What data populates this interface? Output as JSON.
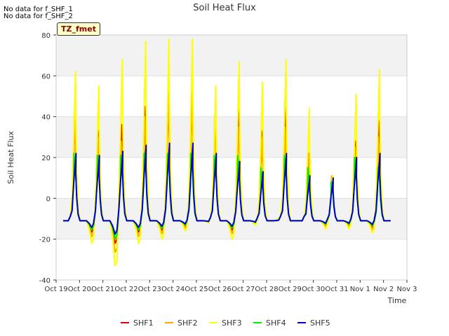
{
  "notes": [
    "No data for f_SHF_1",
    "No data for f_SHF_2"
  ],
  "tz_label": "TZ_fmet",
  "chart_data": {
    "type": "line",
    "title": "Soil Heat Flux",
    "xlabel": "Time",
    "ylabel": "Soil Heat Flux",
    "xlim": [
      0,
      15
    ],
    "ylim": [
      -40,
      80
    ],
    "yticks": [
      -40,
      -20,
      0,
      20,
      40,
      60,
      80
    ],
    "xtick_labels": [
      "Oct 19",
      "Oct 20",
      "Oct 21",
      "Oct 22",
      "Oct 23",
      "Oct 24",
      "Oct 25",
      "Oct 26",
      "Oct 27",
      "Oct 28",
      "Oct 29",
      "Oct 30",
      "Oct 31",
      "Nov 1",
      "Nov 2",
      "Nov 3"
    ],
    "grid_bands": true,
    "legend_position": "bottom",
    "daily": {
      "start_day": 0.3,
      "base": [
        -11,
        -11,
        -11,
        -11,
        -11,
        -11,
        -11,
        -11,
        -11,
        -11,
        -11,
        -11,
        -11,
        -11
      ],
      "trough": [
        -11,
        -22,
        -33,
        -22,
        -20,
        -16,
        -12,
        -20,
        -13,
        -10,
        -11,
        -15,
        -15,
        -17
      ]
    },
    "series": [
      {
        "name": "SHF1",
        "color": "#dd0000",
        "peaks": [
          44,
          33,
          36,
          45,
          55,
          55,
          45,
          45,
          33,
          45,
          22,
          10,
          28,
          38
        ],
        "trough_scale": 0.5
      },
      {
        "name": "SHF2",
        "color": "#ffa500",
        "peaks": [
          42,
          30,
          28,
          40,
          50,
          50,
          40,
          35,
          30,
          35,
          22,
          11,
          25,
          30
        ],
        "trough_scale": 0.7
      },
      {
        "name": "SHF3",
        "color": "#ffff00",
        "peaks": [
          62,
          55,
          68,
          77,
          78,
          78,
          55,
          67,
          57,
          68,
          44,
          11,
          51,
          63
        ],
        "trough_scale": 1.0
      },
      {
        "name": "SHF4",
        "color": "#00ee00",
        "peaks": [
          22,
          21,
          21,
          22,
          22,
          22,
          21,
          21,
          15,
          21,
          15,
          8,
          20,
          15
        ],
        "trough_scale": 0.4
      },
      {
        "name": "SHF5",
        "color": "#0000cc",
        "peaks": [
          22,
          21,
          23,
          26,
          27,
          27,
          22,
          18,
          13,
          22,
          11,
          10,
          20,
          22
        ],
        "trough_scale": 0.3
      }
    ]
  }
}
